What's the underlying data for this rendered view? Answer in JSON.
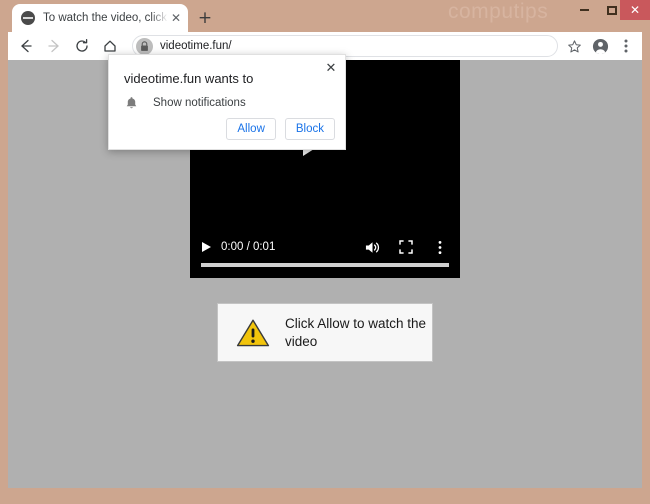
{
  "window": {
    "watermark": "computips",
    "controls": {
      "minimize": "minimize",
      "maximize": "maximize",
      "close": "✕"
    }
  },
  "tabstrip": {
    "tab": {
      "title": "To watch the video, click the Allo",
      "favicon": "globe-icon",
      "close_label": "✕"
    },
    "new_tab_label": "+"
  },
  "toolbar": {
    "back": "back-arrow",
    "forward": "forward-arrow",
    "reload": "reload-icon",
    "home": "home-icon",
    "omnibox": {
      "lock": "lock-icon",
      "url": "videotime.fun/"
    },
    "bookmark": "star-icon",
    "profile": "avatar-icon",
    "menu": "three-dot-menu-icon"
  },
  "page": {
    "video": {
      "play_overlay": "play-icon",
      "play_button": "play-icon",
      "timecode": "0:00 / 0:01",
      "current_time": "0:00",
      "duration": "0:01",
      "volume": "volume-icon",
      "fullscreen": "fullscreen-icon",
      "more": "three-dot-menu-icon",
      "progress_percent": 0
    },
    "warning": {
      "icon": "warning-triangle-icon",
      "text": "Click Allow to watch the video"
    }
  },
  "dialog": {
    "title": "videotime.fun wants to",
    "permission_icon": "bell-icon",
    "permission_label": "Show notifications",
    "allow_label": "Allow",
    "block_label": "Block",
    "close_label": "✕"
  },
  "colors": {
    "frame": "#cda68f",
    "close_button": "#c9585c",
    "page_background": "#b0b0b0",
    "link_blue": "#1a73e8",
    "warning_yellow": "#f2c40c",
    "video_background": "#000000"
  }
}
